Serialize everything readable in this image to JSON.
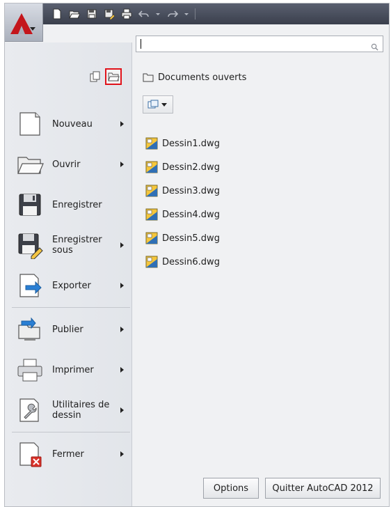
{
  "search": {
    "value": "",
    "placeholder": ""
  },
  "left_menu": {
    "items": [
      {
        "label": "Nouveau",
        "icon": "new-file-icon",
        "has_submenu": true
      },
      {
        "label": "Ouvrir",
        "icon": "open-folder-icon",
        "has_submenu": true
      },
      {
        "label": "Enregistrer",
        "icon": "floppy-disk-icon",
        "has_submenu": false
      },
      {
        "label": "Enregistrer sous",
        "icon": "floppy-save-as-icon",
        "has_submenu": true
      },
      {
        "label": "Exporter",
        "icon": "export-icon",
        "has_submenu": true
      },
      {
        "label": "Publier",
        "icon": "publish-icon",
        "has_submenu": true
      },
      {
        "label": "Imprimer",
        "icon": "printer-icon",
        "has_submenu": true
      },
      {
        "label": "Utilitaires de dessin",
        "icon": "wrench-icon",
        "has_submenu": true
      },
      {
        "label": "Fermer",
        "icon": "close-file-icon",
        "has_submenu": true
      }
    ]
  },
  "right_pane": {
    "title": "Documents ouverts",
    "documents": [
      "Dessin1.dwg",
      "Dessin2.dwg",
      "Dessin3.dwg",
      "Dessin4.dwg",
      "Dessin5.dwg",
      "Dessin6.dwg"
    ]
  },
  "footer": {
    "options_label": "Options",
    "quit_label": "Quitter AutoCAD 2012"
  },
  "colors": {
    "accent_red": "#c4161c",
    "highlight_box": "#e0121a"
  }
}
